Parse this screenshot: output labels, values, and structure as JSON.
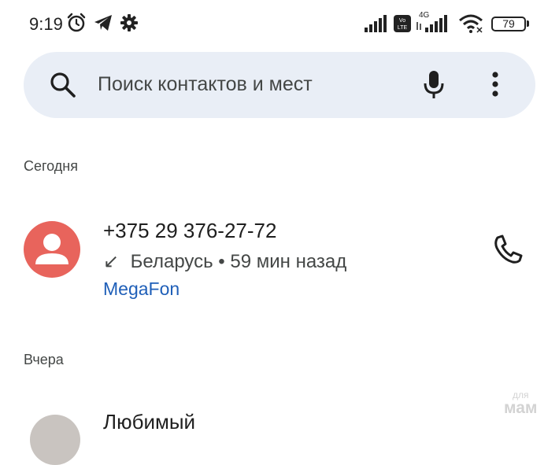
{
  "status_bar": {
    "time": "9:19",
    "volte_badge": "Vo\nLTE",
    "network_type": "4G",
    "battery_level": "79"
  },
  "search": {
    "placeholder": "Поиск контактов и мест"
  },
  "sections": {
    "today": "Сегодня",
    "yesterday": "Вчера"
  },
  "calls": [
    {
      "number": "+375 29 376-27-72",
      "direction_glyph": "↙",
      "details": "Беларусь • 59 мин назад",
      "carrier": "MegaFon"
    },
    {
      "name": "Любимый"
    }
  ],
  "watermark": {
    "line1": "для",
    "line2": "мам"
  },
  "colors": {
    "avatar": "#e8645c",
    "search_bg": "#e9eef6",
    "carrier_link": "#1f5fb8"
  }
}
